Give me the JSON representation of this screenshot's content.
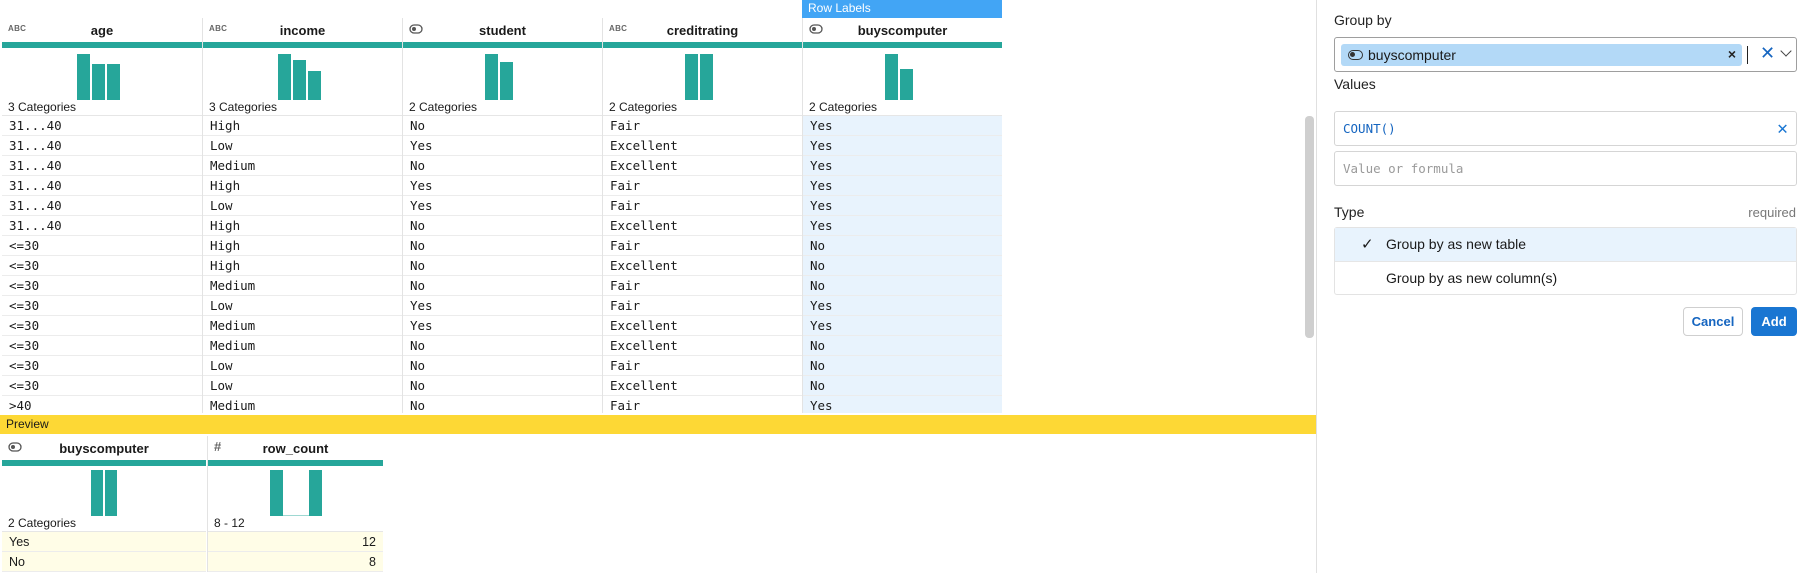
{
  "grid": {
    "row_labels_tag": "Row Labels",
    "columns": [
      {
        "name": "age",
        "type": "ABC",
        "icon": "text-type-icon",
        "categories": "3 Categories",
        "hist": [
          1.0,
          0.78,
          0.78
        ]
      },
      {
        "name": "income",
        "type": "ABC",
        "icon": "text-type-icon",
        "categories": "3 Categories",
        "hist": [
          1.0,
          0.88,
          0.63
        ]
      },
      {
        "name": "student",
        "type": "",
        "icon": "boolean-toggle-icon",
        "categories": "2 Categories",
        "hist": [
          1.0,
          0.83
        ]
      },
      {
        "name": "creditrating",
        "type": "ABC",
        "icon": "text-type-icon",
        "categories": "2 Categories",
        "hist": [
          1.0,
          1.0
        ]
      },
      {
        "name": "buyscomputer",
        "type": "",
        "icon": "boolean-toggle-icon",
        "categories": "2 Categories",
        "hist": [
          1.0,
          0.68
        ]
      }
    ],
    "rows": [
      [
        "31...40",
        "High",
        "No",
        "Fair",
        "Yes"
      ],
      [
        "31...40",
        "Low",
        "Yes",
        "Excellent",
        "Yes"
      ],
      [
        "31...40",
        "Medium",
        "No",
        "Excellent",
        "Yes"
      ],
      [
        "31...40",
        "High",
        "Yes",
        "Fair",
        "Yes"
      ],
      [
        "31...40",
        "Low",
        "Yes",
        "Fair",
        "Yes"
      ],
      [
        "31...40",
        "High",
        "No",
        "Excellent",
        "Yes"
      ],
      [
        "<=30",
        "High",
        "No",
        "Fair",
        "No"
      ],
      [
        "<=30",
        "High",
        "No",
        "Excellent",
        "No"
      ],
      [
        "<=30",
        "Medium",
        "No",
        "Fair",
        "No"
      ],
      [
        "<=30",
        "Low",
        "Yes",
        "Fair",
        "Yes"
      ],
      [
        "<=30",
        "Medium",
        "Yes",
        "Excellent",
        "Yes"
      ],
      [
        "<=30",
        "Medium",
        "No",
        "Excellent",
        "No"
      ],
      [
        "<=30",
        "Low",
        "No",
        "Fair",
        "No"
      ],
      [
        "<=30",
        "Low",
        "No",
        "Excellent",
        "No"
      ],
      [
        ">40",
        "Medium",
        "No",
        "Fair",
        "Yes"
      ]
    ]
  },
  "preview": {
    "label": "Preview",
    "columns": [
      {
        "name": "buyscomputer",
        "icon": "boolean-toggle-icon",
        "summary": "2 Categories"
      },
      {
        "name": "row_count",
        "icon": "number-hash-icon",
        "summary": "8 - 12"
      }
    ],
    "rows": [
      [
        "Yes",
        "12"
      ],
      [
        "No",
        "8"
      ]
    ]
  },
  "panel": {
    "group_by_label": "Group by",
    "group_by_chip": "buyscomputer",
    "values_label": "Values",
    "value_formula": "COUNT()",
    "value_placeholder": "Value or formula",
    "type_label": "Type",
    "required_text": "required",
    "type_options": [
      {
        "label": "Group by as new table",
        "selected": true
      },
      {
        "label": "Group by as new column(s)",
        "selected": false
      }
    ],
    "cancel_label": "Cancel",
    "add_label": "Add"
  },
  "colors": {
    "teal": "#26a69a",
    "row_labels_blue": "#42a5f5",
    "preview_yellow": "#fdd835",
    "primary": "#1976d2"
  }
}
